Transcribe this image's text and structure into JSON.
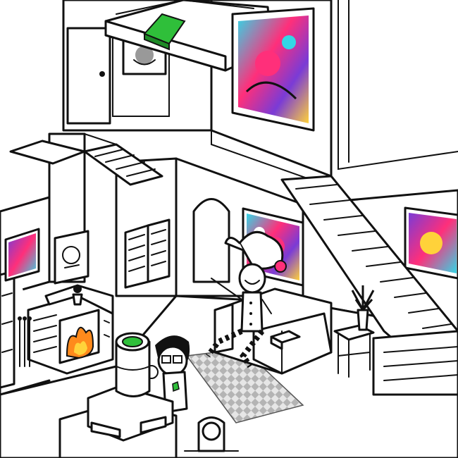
{
  "scene": {
    "type": "isometric-house-interior",
    "palette": {
      "outline": "#111111",
      "floor": "#ffffff",
      "rug_light": "#e6e6e6",
      "rug_dark": "#b4b4b4",
      "fire": "#ff8a1c",
      "flame_core": "#ffd23a",
      "cake_green": "#2fbf3a",
      "painting_pink": "#ff2f7a",
      "painting_cyan": "#33d6e6",
      "painting_purple": "#7a3bd6"
    },
    "icons": [
      "fireplace-icon",
      "fire-icon",
      "jester-doll-icon",
      "kid-character-icon",
      "cake-icon",
      "couch-icon",
      "side-table-icon",
      "plant-icon",
      "staircase-icon",
      "saloon-doors-icon",
      "painting-icon",
      "portrait-icon",
      "door-icon",
      "mirror-icon"
    ]
  }
}
